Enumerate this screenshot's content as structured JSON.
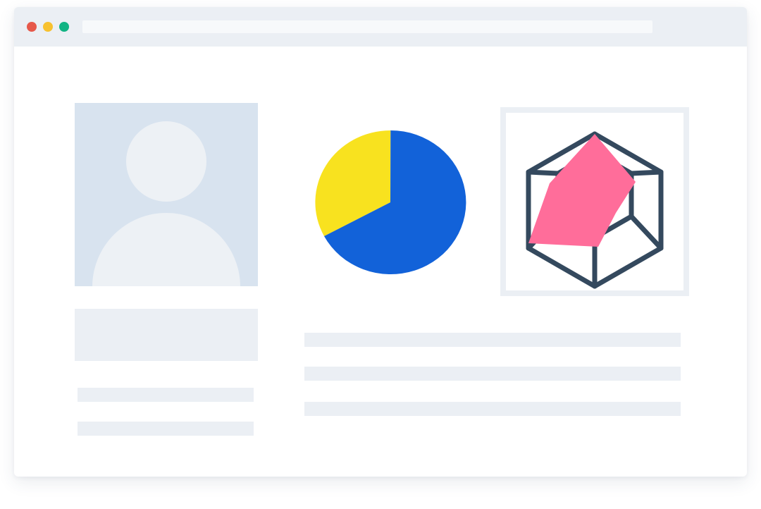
{
  "colors": {
    "window_bg": "#ffffff",
    "titlebar_bg": "#ebeff4",
    "address_bar_bg": "#f7f9fb",
    "dot_red": "#e6584a",
    "dot_yellow": "#f7c12f",
    "dot_green": "#11b383",
    "placeholder_block": "#ebeff4",
    "avatar_bg": "#d8e3ef",
    "avatar_figure": "#edf1f5",
    "pie_blue": "#1262d9",
    "pie_yellow": "#f8e21f",
    "cube_stroke": "#34495e",
    "cube_fill": "#ff6d9a"
  },
  "window": {
    "controls": [
      "close-dot",
      "minimize-dot",
      "maximize-dot"
    ],
    "address_bar_text": ""
  },
  "profile": {
    "avatar_icon": "user-silhouette-icon"
  },
  "media": {
    "pie_icon": "pie-chart-icon",
    "pie_share_blue": 0.69,
    "pie_share_yellow": 0.31,
    "cube_icon": "wireframe-cube-icon"
  }
}
